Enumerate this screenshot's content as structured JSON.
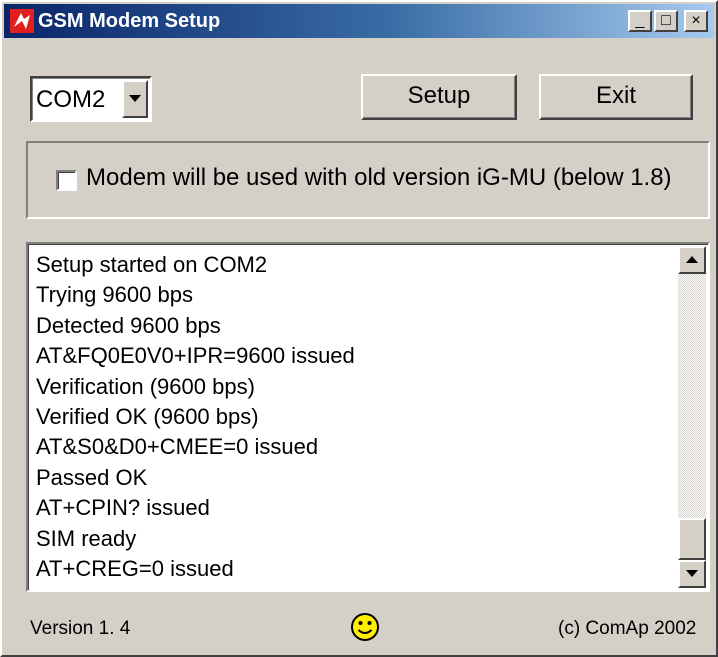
{
  "window": {
    "title": "GSM Modem Setup"
  },
  "titlebar_buttons": {
    "minimize": "_",
    "maximize": "□",
    "close": "×"
  },
  "port_select": {
    "value": "COM2"
  },
  "buttons": {
    "setup": "Setup",
    "exit": "Exit"
  },
  "options": {
    "old_version_checkbox": {
      "label": "Modem will be used with old version iG-MU (below 1.8)",
      "checked": false
    }
  },
  "log": {
    "lines": [
      "Setup started on COM2",
      "Trying 9600 bps",
      "Detected 9600 bps",
      "AT&FQ0E0V0+IPR=9600 issued",
      "Verification (9600 bps)",
      "Verified OK (9600 bps)",
      "AT&S0&D0+CMEE=0 issued",
      "Passed OK",
      "AT+CPIN? issued",
      "SIM ready",
      "AT+CREG=0 issued"
    ]
  },
  "status": {
    "version": "Version 1. 4",
    "copyright": "(c) ComAp 2002",
    "state_icon": "smiley-icon"
  },
  "colors": {
    "face": "#d4d0c8",
    "title_start": "#0a246a",
    "title_end": "#a6caf0",
    "smiley": "#ffee00"
  }
}
